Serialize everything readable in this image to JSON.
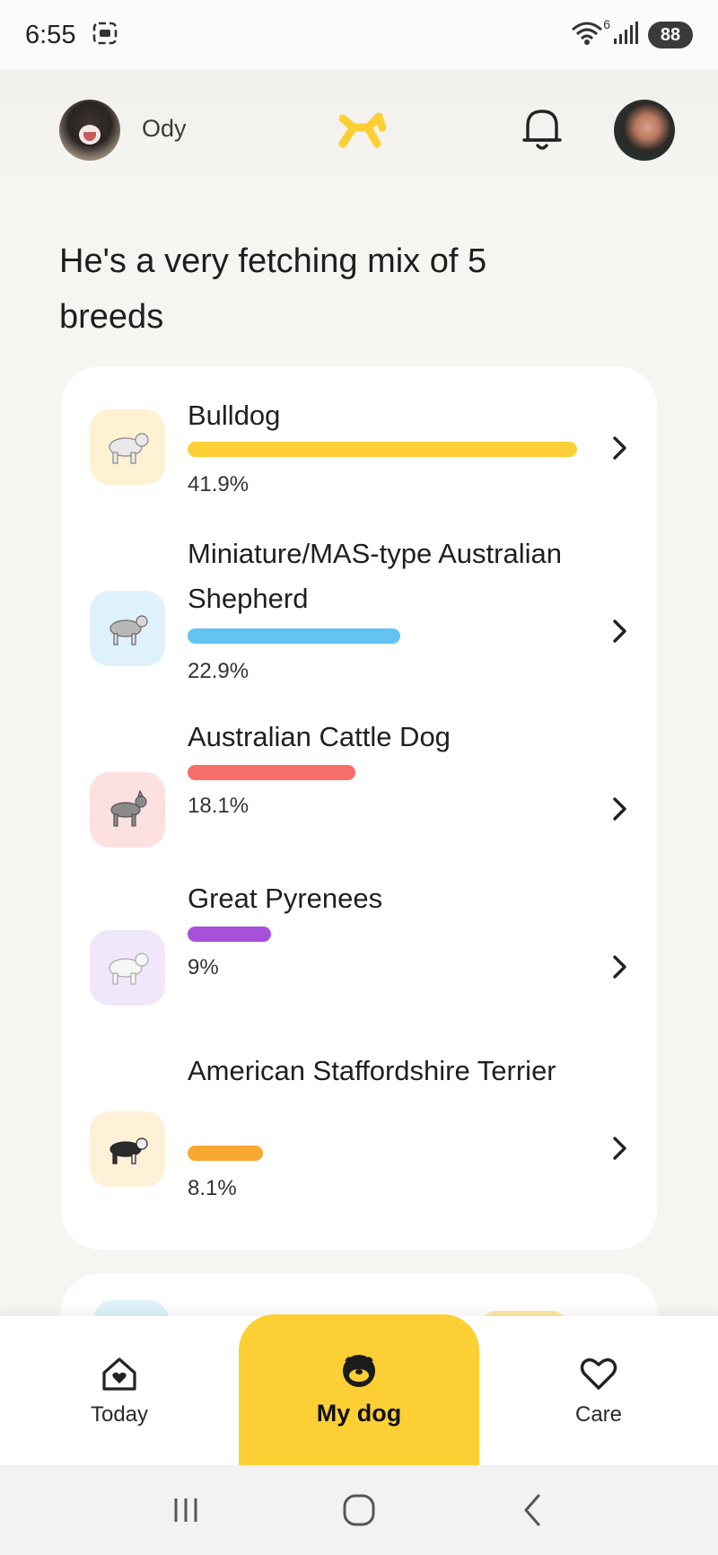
{
  "status_bar": {
    "time": "6:55",
    "battery": "88",
    "wifi_badge": "6"
  },
  "header": {
    "dog_name": "Ody",
    "accent_color": "#fcd034"
  },
  "headline": "He's a very fetching mix of 5 breeds",
  "breeds": [
    {
      "name": "Bulldog",
      "percent_label": "41.9%",
      "percent": 41.9,
      "color": "#fdd036",
      "thumb_bg": "#fff2d2"
    },
    {
      "name": "Miniature/MAS-type Australian Shepherd",
      "percent_label": "22.9%",
      "percent": 22.9,
      "color": "#63c3f3",
      "thumb_bg": "#dff1fb"
    },
    {
      "name": "Australian Cattle Dog",
      "percent_label": "18.1%",
      "percent": 18.1,
      "color": "#f86c6c",
      "thumb_bg": "#fde0e0"
    },
    {
      "name": "Great Pyrenees",
      "percent_label": "9%",
      "percent": 9,
      "color": "#a651d9",
      "thumb_bg": "#f1e7fb"
    },
    {
      "name": "American Staffordshire Terrier",
      "percent_label": "8.1%",
      "percent": 8.1,
      "color": "#f9a830",
      "thumb_bg": "#fff0d8"
    }
  ],
  "bottom_nav": {
    "today": "Today",
    "my_dog": "My dog",
    "care": "Care"
  }
}
